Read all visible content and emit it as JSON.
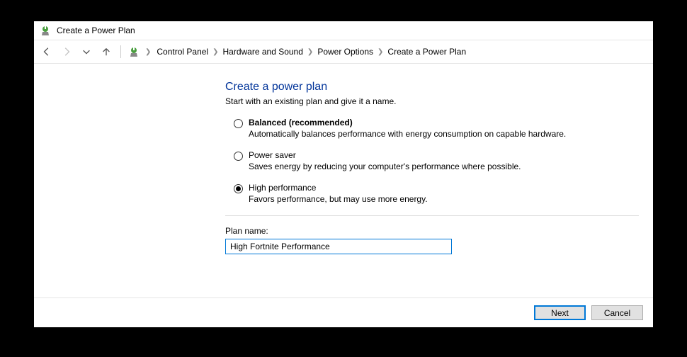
{
  "window": {
    "title": "Create a Power Plan"
  },
  "breadcrumb": {
    "items": [
      "Control Panel",
      "Hardware and Sound",
      "Power Options",
      "Create a Power Plan"
    ]
  },
  "page": {
    "heading": "Create a power plan",
    "subheading": "Start with an existing plan and give it a name.",
    "options": [
      {
        "label": "Balanced (recommended)",
        "desc": "Automatically balances performance with energy consumption on capable hardware.",
        "bold": true,
        "checked": false
      },
      {
        "label": "Power saver",
        "desc": "Saves energy by reducing your computer's performance where possible.",
        "bold": false,
        "checked": false
      },
      {
        "label": "High performance",
        "desc": "Favors performance, but may use more energy.",
        "bold": false,
        "checked": true
      }
    ],
    "plan_name_label": "Plan name:",
    "plan_name_value": "High Fortnite Performance"
  },
  "footer": {
    "next": "Next",
    "cancel": "Cancel"
  }
}
